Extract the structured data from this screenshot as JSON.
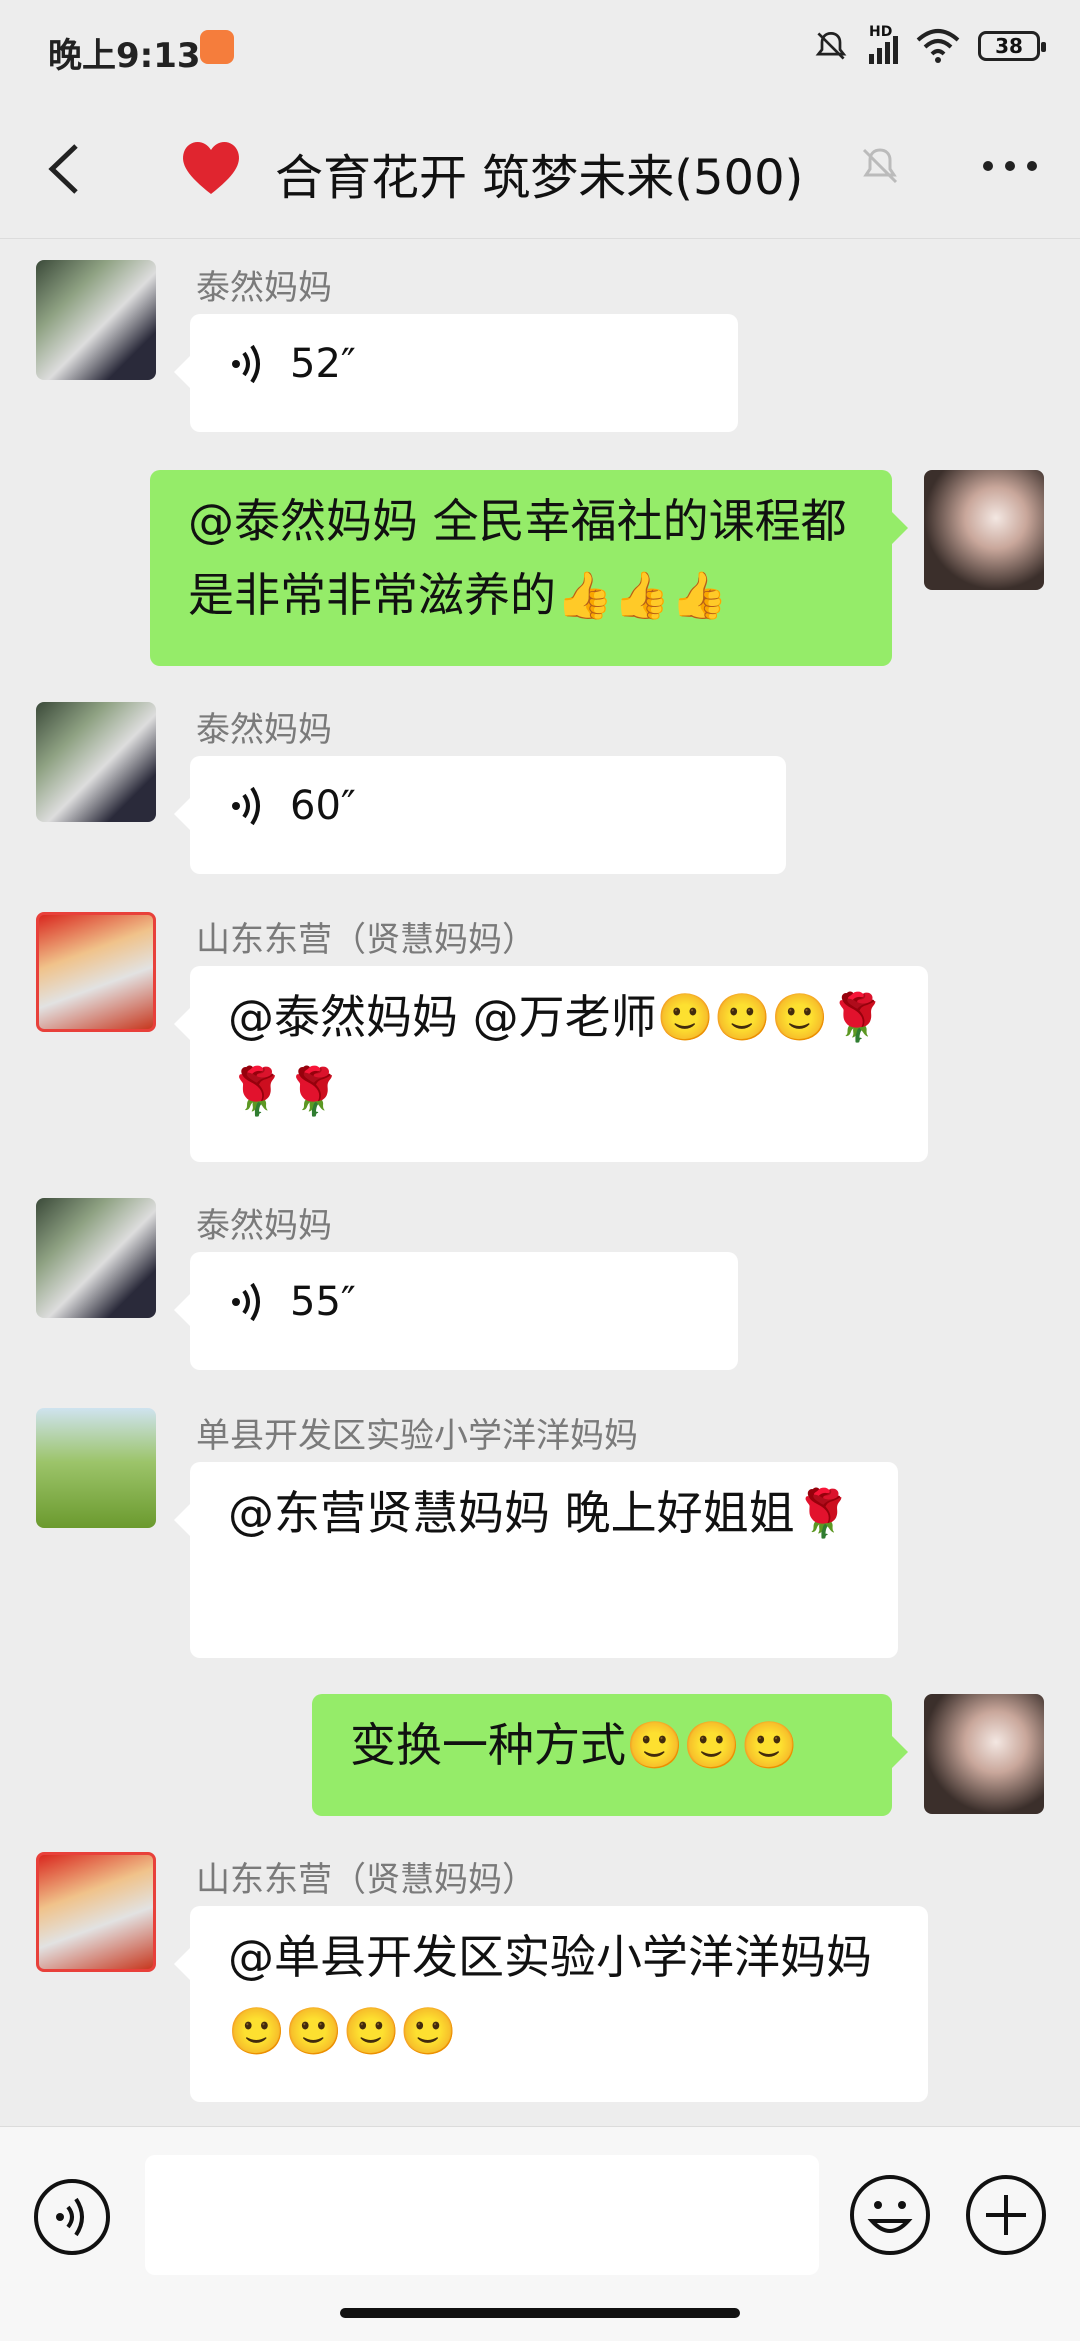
{
  "status_bar": {
    "time": "晚上9:13",
    "network_label": "HD",
    "battery": "38"
  },
  "header": {
    "title": "合育花开 筑梦未来(500)"
  },
  "messages": [
    {
      "sender": "泰然妈妈",
      "duration": "52″"
    },
    {
      "text": "@泰然妈妈  全民幸福社的课程都是非常非常滋养的👍👍👍"
    },
    {
      "sender": "泰然妈妈",
      "duration": "60″"
    },
    {
      "sender": "山东东营（贤慧妈妈）",
      "text": "@泰然妈妈  @万老师🙂🙂🙂🌹🌹🌹"
    },
    {
      "sender": "泰然妈妈",
      "duration": "55″"
    },
    {
      "sender": "单县开发区实验小学洋洋妈妈",
      "text": "@东营贤慧妈妈  晚上好姐姐🌹"
    },
    {
      "text": "变换一种方式🙂🙂🙂"
    },
    {
      "sender": "山东东营（贤慧妈妈）",
      "text": "@单县开发区实验小学洋洋妈妈 🙂🙂🙂🙂"
    }
  ],
  "input": {
    "placeholder": ""
  },
  "colors": {
    "background": "#ededed",
    "my_bubble": "#95ec69",
    "other_bubble": "#ffffff",
    "accent": "#07c160"
  }
}
